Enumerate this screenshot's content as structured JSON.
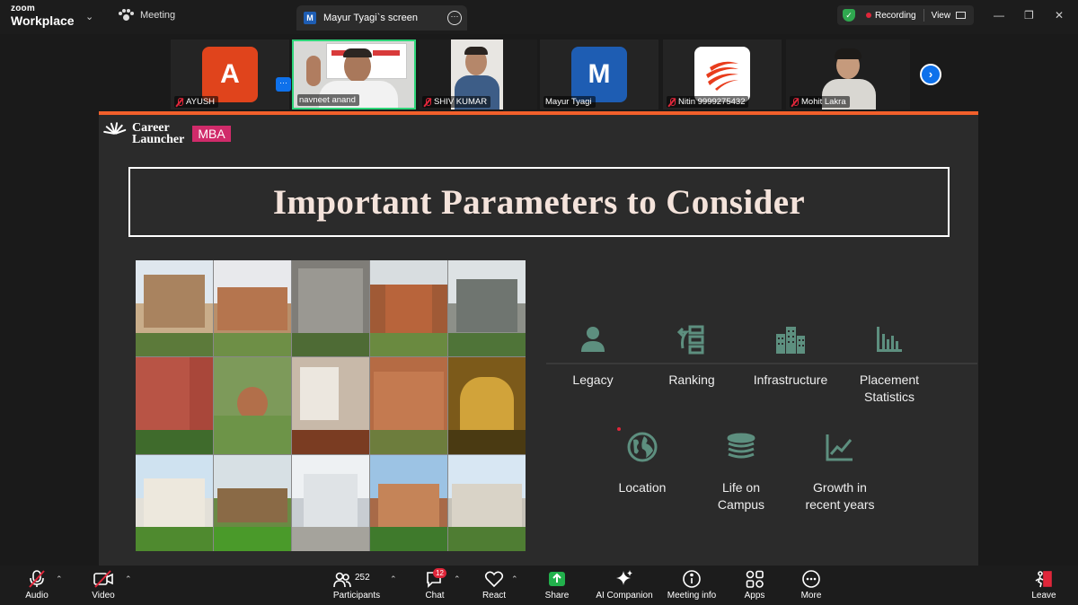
{
  "topbar": {
    "brand_small": "zoom",
    "brand_large": "Workplace",
    "meeting_label": "Meeting",
    "screen_badge": "M",
    "screen_tab": "Mayur Tyagi`s screen",
    "recording_label": "Recording",
    "view_label": "View"
  },
  "participants": [
    {
      "name": "AYUSH",
      "initial": "A",
      "muted": true,
      "avatar_color": "#e0441c"
    },
    {
      "name": "navneet anand",
      "muted": false,
      "active": true
    },
    {
      "name": "SHIV KUMAR",
      "muted": true
    },
    {
      "name": "Mayur Tyagi",
      "initial": "M",
      "muted": false,
      "avatar_color": "#1e5db3"
    },
    {
      "name": "Nitin 9999275432",
      "muted": true
    },
    {
      "name": "Mohit Lakra",
      "muted": true
    }
  ],
  "slide": {
    "logo_line1": "Career",
    "logo_line2": "Launcher",
    "logo_tag": "MBA",
    "title": "Important Parameters to Consider",
    "parameters": [
      {
        "icon": "person-icon",
        "label": "Legacy"
      },
      {
        "icon": "ranking-icon",
        "label": "Ranking"
      },
      {
        "icon": "buildings-icon",
        "label": "Infrastructure"
      },
      {
        "icon": "bar-chart-icon",
        "label_line1": "Placement",
        "label_line2": "Statistics"
      },
      {
        "icon": "globe-icon",
        "label": "Location"
      },
      {
        "icon": "stack-icon",
        "label_line1": "Life on",
        "label_line2": "Campus"
      },
      {
        "icon": "trend-icon",
        "label_line1": "Growth in",
        "label_line2": "recent years"
      }
    ]
  },
  "toolbar": {
    "audio": "Audio",
    "video": "Video",
    "participants": "Participants",
    "participant_count": "252",
    "chat": "Chat",
    "chat_badge": "12",
    "react": "React",
    "share": "Share",
    "ai_companion": "AI Companion",
    "meeting_info": "Meeting info",
    "apps": "Apps",
    "more": "More",
    "leave": "Leave"
  },
  "colors": {
    "accent_orange": "#f2602b",
    "icon_green": "#5d8f7f",
    "active_speaker": "#2fd67a",
    "zoom_blue": "#0e71eb",
    "mute_red": "#e0263a"
  }
}
